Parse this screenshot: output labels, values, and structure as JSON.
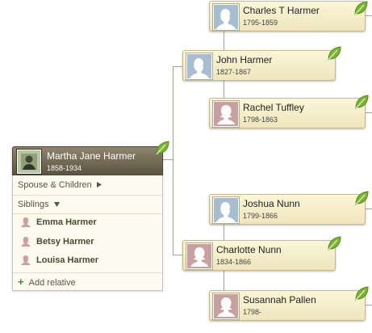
{
  "focus_person": {
    "name": "Martha Jane Harmer",
    "dates": "1858-1934"
  },
  "family_panel": {
    "spouse_children_label": "Spouse & Children",
    "siblings_label": "Siblings",
    "siblings": [
      {
        "name": "Emma Harmer"
      },
      {
        "name": "Betsy Harmer"
      },
      {
        "name": "Louisa Harmer"
      }
    ],
    "add_relative_label": "Add relative"
  },
  "ancestors": {
    "father": {
      "name": "John Harmer",
      "dates": "1827-1867"
    },
    "mother": {
      "name": "Charlotte Nunn",
      "dates": "1834-1866"
    },
    "paternal_grandfather": {
      "name": "Charles T Harmer",
      "dates": "1795-1859"
    },
    "paternal_grandmother": {
      "name": "Rachel Tuffley",
      "dates": "1798-1863"
    },
    "maternal_grandfather": {
      "name": "Joshua Nunn",
      "dates": "1799-1866"
    },
    "maternal_grandmother": {
      "name": "Susannah Pallen",
      "dates": "1798-"
    }
  },
  "icons": {
    "hint": "leaf-icon",
    "male_silhouette": "male-silhouette-icon",
    "female_silhouette": "female-silhouette-icon",
    "expand_right": "triangle-right-icon",
    "expand_down": "triangle-down-icon",
    "add": "plus-icon"
  },
  "colors": {
    "card_background": "#efe6bd",
    "focus_card": "#6f6652",
    "male_photo": "#a7bdd2",
    "female_photo": "#c9a09f",
    "leaf_green": "#7cb52f",
    "connector": "#a8a48c"
  }
}
